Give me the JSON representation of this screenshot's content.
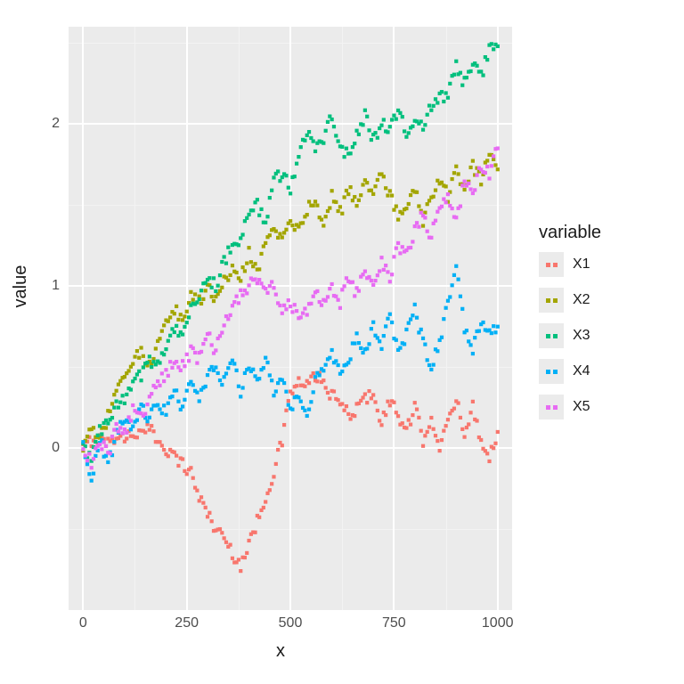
{
  "chart_data": {
    "type": "scatter",
    "xlabel": "x",
    "ylabel": "value",
    "legend_title": "variable",
    "xlim": [
      -35,
      1035
    ],
    "ylim": [
      -1.0,
      2.6
    ],
    "x_ticks": [
      0,
      250,
      500,
      750,
      1000
    ],
    "y_ticks": [
      0,
      1,
      2
    ],
    "x_minor": [
      125,
      375,
      625,
      875
    ],
    "y_minor": [
      -0.5,
      0.5,
      1.5,
      2.5
    ],
    "series": [
      {
        "name": "X1",
        "color": "#F8766D",
        "points": [
          [
            0,
            0.0
          ],
          [
            20,
            0.05
          ],
          [
            40,
            0.06
          ],
          [
            60,
            0.03
          ],
          [
            80,
            0.08
          ],
          [
            100,
            0.06
          ],
          [
            120,
            0.1
          ],
          [
            140,
            0.08
          ],
          [
            160,
            0.12
          ],
          [
            180,
            0.05
          ],
          [
            200,
            0.0
          ],
          [
            220,
            -0.05
          ],
          [
            240,
            -0.1
          ],
          [
            260,
            -0.15
          ],
          [
            280,
            -0.3
          ],
          [
            300,
            -0.4
          ],
          [
            320,
            -0.5
          ],
          [
            340,
            -0.55
          ],
          [
            360,
            -0.65
          ],
          [
            380,
            -0.72
          ],
          [
            400,
            -0.6
          ],
          [
            420,
            -0.45
          ],
          [
            440,
            -0.3
          ],
          [
            460,
            -0.15
          ],
          [
            480,
            0.05
          ],
          [
            500,
            0.35
          ],
          [
            520,
            0.4
          ],
          [
            540,
            0.38
          ],
          [
            560,
            0.45
          ],
          [
            580,
            0.4
          ],
          [
            600,
            0.32
          ],
          [
            620,
            0.28
          ],
          [
            640,
            0.2
          ],
          [
            660,
            0.25
          ],
          [
            680,
            0.3
          ],
          [
            700,
            0.35
          ],
          [
            720,
            0.15
          ],
          [
            740,
            0.3
          ],
          [
            760,
            0.2
          ],
          [
            780,
            0.1
          ],
          [
            800,
            0.25
          ],
          [
            820,
            0.05
          ],
          [
            840,
            0.2
          ],
          [
            860,
            0.0
          ],
          [
            880,
            0.15
          ],
          [
            900,
            0.3
          ],
          [
            920,
            0.1
          ],
          [
            940,
            0.25
          ],
          [
            960,
            0.05
          ],
          [
            980,
            -0.05
          ],
          [
            1000,
            0.1
          ]
        ]
      },
      {
        "name": "X2",
        "color": "#A3A500",
        "points": [
          [
            0,
            0.0
          ],
          [
            20,
            0.1
          ],
          [
            40,
            0.05
          ],
          [
            60,
            0.2
          ],
          [
            80,
            0.35
          ],
          [
            100,
            0.45
          ],
          [
            120,
            0.55
          ],
          [
            140,
            0.6
          ],
          [
            160,
            0.5
          ],
          [
            180,
            0.65
          ],
          [
            200,
            0.75
          ],
          [
            220,
            0.85
          ],
          [
            240,
            0.8
          ],
          [
            260,
            0.95
          ],
          [
            280,
            0.9
          ],
          [
            300,
            1.0
          ],
          [
            320,
            0.92
          ],
          [
            340,
            1.05
          ],
          [
            360,
            1.1
          ],
          [
            380,
            1.05
          ],
          [
            400,
            1.2
          ],
          [
            420,
            1.1
          ],
          [
            440,
            1.25
          ],
          [
            460,
            1.35
          ],
          [
            480,
            1.3
          ],
          [
            500,
            1.4
          ],
          [
            520,
            1.35
          ],
          [
            540,
            1.48
          ],
          [
            560,
            1.5
          ],
          [
            580,
            1.4
          ],
          [
            600,
            1.55
          ],
          [
            620,
            1.45
          ],
          [
            640,
            1.6
          ],
          [
            660,
            1.5
          ],
          [
            680,
            1.65
          ],
          [
            700,
            1.55
          ],
          [
            720,
            1.7
          ],
          [
            740,
            1.55
          ],
          [
            760,
            1.45
          ],
          [
            780,
            1.5
          ],
          [
            800,
            1.6
          ],
          [
            820,
            1.4
          ],
          [
            840,
            1.55
          ],
          [
            860,
            1.65
          ],
          [
            880,
            1.55
          ],
          [
            900,
            1.7
          ],
          [
            920,
            1.6
          ],
          [
            940,
            1.75
          ],
          [
            960,
            1.65
          ],
          [
            980,
            1.8
          ],
          [
            1000,
            1.72
          ]
        ]
      },
      {
        "name": "X3",
        "color": "#00BF7D",
        "points": [
          [
            0,
            0.0
          ],
          [
            20,
            -0.05
          ],
          [
            40,
            0.1
          ],
          [
            60,
            0.15
          ],
          [
            80,
            0.25
          ],
          [
            100,
            0.3
          ],
          [
            120,
            0.4
          ],
          [
            140,
            0.45
          ],
          [
            160,
            0.55
          ],
          [
            180,
            0.5
          ],
          [
            200,
            0.65
          ],
          [
            220,
            0.75
          ],
          [
            240,
            0.7
          ],
          [
            260,
            0.85
          ],
          [
            280,
            0.95
          ],
          [
            300,
            1.05
          ],
          [
            320,
            1.0
          ],
          [
            340,
            1.15
          ],
          [
            360,
            1.25
          ],
          [
            380,
            1.3
          ],
          [
            400,
            1.45
          ],
          [
            420,
            1.5
          ],
          [
            440,
            1.4
          ],
          [
            460,
            1.65
          ],
          [
            480,
            1.7
          ],
          [
            500,
            1.6
          ],
          [
            520,
            1.8
          ],
          [
            540,
            1.95
          ],
          [
            560,
            1.85
          ],
          [
            580,
            1.9
          ],
          [
            600,
            2.05
          ],
          [
            620,
            1.85
          ],
          [
            640,
            1.8
          ],
          [
            660,
            1.95
          ],
          [
            680,
            2.05
          ],
          [
            700,
            1.9
          ],
          [
            720,
            2.0
          ],
          [
            740,
            1.95
          ],
          [
            760,
            2.1
          ],
          [
            780,
            1.95
          ],
          [
            800,
            2.05
          ],
          [
            820,
            2.0
          ],
          [
            840,
            2.1
          ],
          [
            860,
            2.15
          ],
          [
            880,
            2.2
          ],
          [
            900,
            2.35
          ],
          [
            920,
            2.25
          ],
          [
            940,
            2.4
          ],
          [
            960,
            2.3
          ],
          [
            980,
            2.45
          ],
          [
            1000,
            2.48
          ]
        ]
      },
      {
        "name": "X4",
        "color": "#00B0F6",
        "points": [
          [
            0,
            0.0
          ],
          [
            20,
            -0.2
          ],
          [
            40,
            0.05
          ],
          [
            60,
            -0.1
          ],
          [
            80,
            0.08
          ],
          [
            100,
            0.2
          ],
          [
            120,
            0.1
          ],
          [
            140,
            0.25
          ],
          [
            160,
            0.18
          ],
          [
            180,
            0.3
          ],
          [
            200,
            0.2
          ],
          [
            220,
            0.35
          ],
          [
            240,
            0.25
          ],
          [
            260,
            0.4
          ],
          [
            280,
            0.32
          ],
          [
            300,
            0.45
          ],
          [
            320,
            0.5
          ],
          [
            340,
            0.4
          ],
          [
            360,
            0.55
          ],
          [
            380,
            0.35
          ],
          [
            400,
            0.5
          ],
          [
            420,
            0.4
          ],
          [
            440,
            0.55
          ],
          [
            460,
            0.35
          ],
          [
            480,
            0.45
          ],
          [
            500,
            0.25
          ],
          [
            520,
            0.3
          ],
          [
            540,
            0.2
          ],
          [
            560,
            0.4
          ],
          [
            580,
            0.5
          ],
          [
            600,
            0.6
          ],
          [
            620,
            0.45
          ],
          [
            640,
            0.55
          ],
          [
            660,
            0.7
          ],
          [
            680,
            0.6
          ],
          [
            700,
            0.75
          ],
          [
            720,
            0.65
          ],
          [
            740,
            0.8
          ],
          [
            760,
            0.6
          ],
          [
            780,
            0.7
          ],
          [
            800,
            0.85
          ],
          [
            820,
            0.65
          ],
          [
            840,
            0.5
          ],
          [
            860,
            0.65
          ],
          [
            880,
            0.9
          ],
          [
            900,
            1.15
          ],
          [
            920,
            0.75
          ],
          [
            940,
            0.6
          ],
          [
            960,
            0.8
          ],
          [
            980,
            0.7
          ],
          [
            1000,
            0.75
          ]
        ]
      },
      {
        "name": "X5",
        "color": "#E76BF3",
        "points": [
          [
            0,
            0.0
          ],
          [
            20,
            -0.1
          ],
          [
            40,
            0.05
          ],
          [
            60,
            -0.05
          ],
          [
            80,
            0.15
          ],
          [
            100,
            0.08
          ],
          [
            120,
            0.25
          ],
          [
            140,
            0.18
          ],
          [
            160,
            0.3
          ],
          [
            180,
            0.4
          ],
          [
            200,
            0.45
          ],
          [
            220,
            0.55
          ],
          [
            240,
            0.5
          ],
          [
            260,
            0.6
          ],
          [
            280,
            0.55
          ],
          [
            300,
            0.7
          ],
          [
            320,
            0.6
          ],
          [
            340,
            0.75
          ],
          [
            360,
            0.85
          ],
          [
            380,
            0.95
          ],
          [
            400,
            1.0
          ],
          [
            420,
            1.05
          ],
          [
            440,
            0.95
          ],
          [
            460,
            1.0
          ],
          [
            480,
            0.85
          ],
          [
            500,
            0.9
          ],
          [
            520,
            0.8
          ],
          [
            540,
            0.85
          ],
          [
            560,
            0.95
          ],
          [
            580,
            0.9
          ],
          [
            600,
            1.0
          ],
          [
            620,
            0.9
          ],
          [
            640,
            1.05
          ],
          [
            660,
            0.95
          ],
          [
            680,
            1.1
          ],
          [
            700,
            1.0
          ],
          [
            720,
            1.15
          ],
          [
            740,
            1.05
          ],
          [
            760,
            1.25
          ],
          [
            780,
            1.2
          ],
          [
            800,
            1.35
          ],
          [
            820,
            1.45
          ],
          [
            840,
            1.3
          ],
          [
            860,
            1.5
          ],
          [
            880,
            1.55
          ],
          [
            900,
            1.4
          ],
          [
            920,
            1.65
          ],
          [
            940,
            1.55
          ],
          [
            960,
            1.75
          ],
          [
            980,
            1.7
          ],
          [
            1000,
            1.85
          ]
        ]
      }
    ]
  }
}
